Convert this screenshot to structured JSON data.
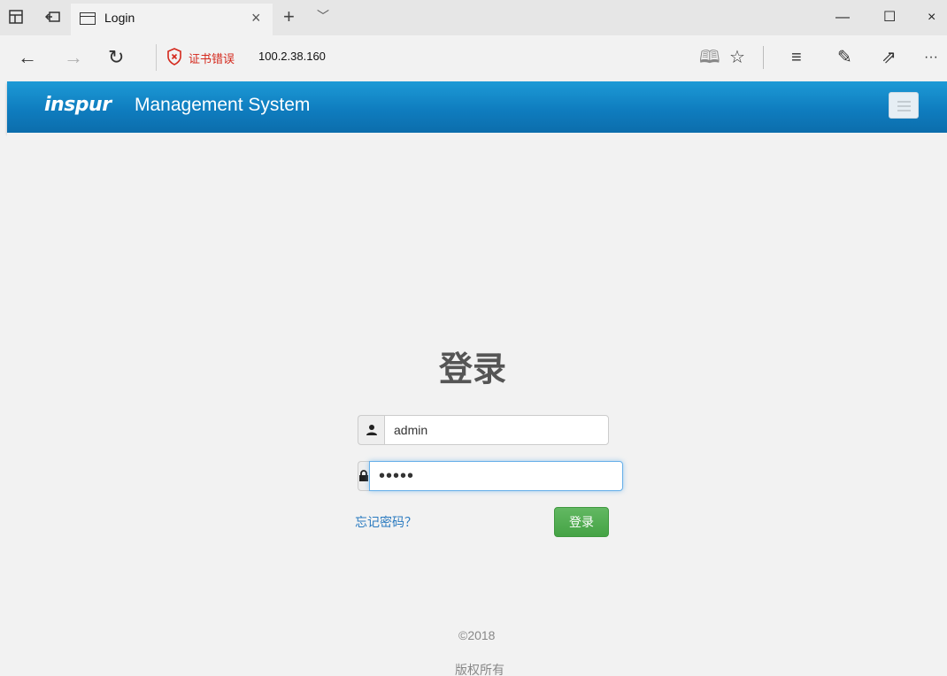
{
  "window": {
    "tab_title": "Login",
    "tab_close_glyph": "×",
    "new_tab_glyph": "+",
    "tab_list_glyph": "﹀",
    "minimize_glyph": "—",
    "maximize_glyph": "☐",
    "close_glyph": "×"
  },
  "address_bar": {
    "back_glyph": "←",
    "forward_glyph": "→",
    "refresh_glyph": "↻",
    "cert_error_label": "证书错误",
    "url": "100.2.38.160",
    "reading_view_glyph": "🕮",
    "favorite_glyph": "☆",
    "hub_glyph": "≡",
    "notes_glyph": "✎",
    "share_glyph": "⇗",
    "more_glyph": "···",
    "accent_error_color": "#d4281c"
  },
  "app_header": {
    "logo_text": "inspur",
    "title": "Management System",
    "gradient_top": "#1d9ad6",
    "gradient_bottom": "#0c6dac"
  },
  "login": {
    "heading": "登录",
    "username_value": "admin",
    "password_value": "•••••",
    "forgot_password_label": "忘记密码？",
    "submit_label": "登录",
    "submit_color": "#4cae4c"
  },
  "footer": {
    "copyright": "©2018",
    "rights": "版权所有"
  }
}
